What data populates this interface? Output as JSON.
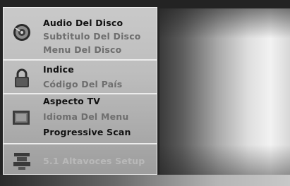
{
  "menu": {
    "groups": [
      {
        "icon": "disc-icon",
        "items": [
          {
            "label": "Audio Del Disco",
            "state": "active"
          },
          {
            "label": "Subtitulo Del Disco",
            "state": "muted"
          },
          {
            "label": "Menu Del Disco",
            "state": "muted"
          }
        ]
      },
      {
        "icon": "lock-icon",
        "items": [
          {
            "label": "Indice",
            "state": "active"
          },
          {
            "label": "Código Del País",
            "state": "muted"
          }
        ]
      },
      {
        "icon": "tv-screen-icon",
        "items": [
          {
            "label": "Aspecto TV",
            "state": "active"
          },
          {
            "label": "Idioma Del Menu",
            "state": "muted"
          },
          {
            "label": "Progressive Scan",
            "state": "active"
          }
        ]
      },
      {
        "icon": "speaker-icon",
        "items": [
          {
            "label": "5.1 Altavoces Setup",
            "state": "faded"
          }
        ]
      }
    ]
  },
  "colors": {
    "panel": "#c2c2c2",
    "divider": "#ececec",
    "active_text": "#111111",
    "muted_text": "#6e6e6e",
    "faded_text": "#b9b9b9"
  }
}
